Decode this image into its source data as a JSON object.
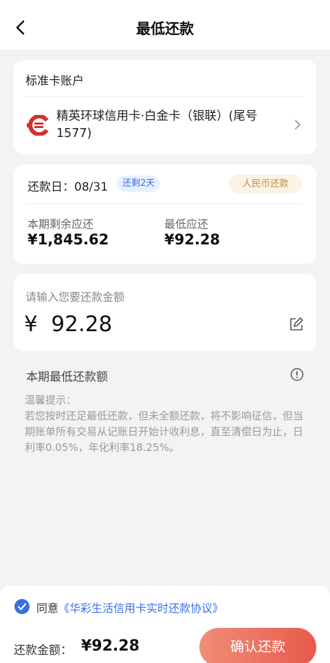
{
  "nav": {
    "title": "最低还款",
    "back_icon": "chevron-left-icon"
  },
  "account": {
    "header": "标准卡账户",
    "card_name": "精英环球信用卡·白金卡（银联）(尾号1577)",
    "logo_icon": "bank-logo",
    "brand_color": "#d3302f"
  },
  "repay_info": {
    "due_label": "还款日：08/31",
    "remaining_tag": "还剩2天",
    "currency_tag": "人民币还款",
    "balance_label": "本期剩余应还",
    "balance_value": "¥1,845.62",
    "min_label": "最低应还",
    "min_value": "¥92.28"
  },
  "amount_input": {
    "placeholder": "请输入您要还款金额",
    "value": "¥  92.28",
    "edit_icon": "edit-icon"
  },
  "min_section": {
    "label": "本期最低还款额",
    "info_icon": "info-icon",
    "tips": "温馨提示：\n若您按时还足最低还款，但未全额还款，将不影响征信，但当期账单所有交易从记账日开始计收利息，直至清偿日为止，日利率0.05%，年化利率18.25%。"
  },
  "bottom": {
    "agree_prefix": "同意",
    "agree_link": "《华彩生活信用卡实时还款协议》",
    "agreed": true,
    "total_label": "还款金额：",
    "total_value": "¥92.28",
    "confirm_label": "确认还款",
    "accent": "#3a6ee8"
  }
}
